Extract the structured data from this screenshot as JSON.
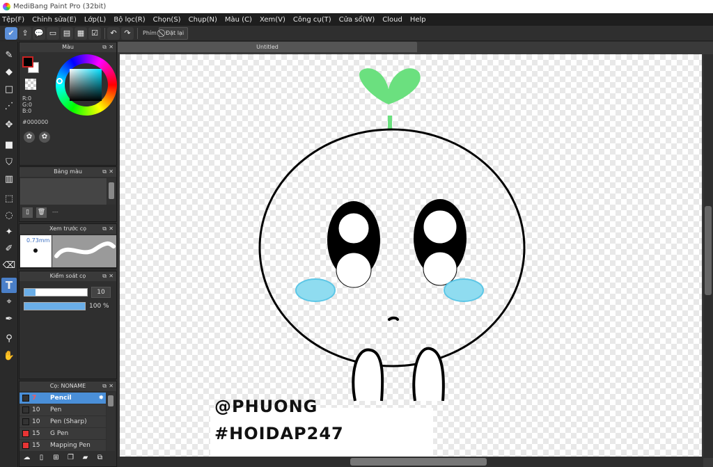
{
  "window": {
    "title": "MediBang Paint Pro (32bit)"
  },
  "menu": [
    "Tệp(F)",
    "Chỉnh sửa(E)",
    "Lớp(L)",
    "Bộ lọc(R)",
    "Chọn(S)",
    "Chụp(N)",
    "Màu (C)",
    "Xem(V)",
    "Công cụ(T)",
    "Cửa sổ(W)",
    "Cloud",
    "Help"
  ],
  "toolbar": {
    "shortcut_label": "Phím",
    "reset_label": "Đặt lại"
  },
  "color_panel": {
    "title": "Màu",
    "r": "R:0",
    "g": "G:0",
    "b": "B:0",
    "hex": "#000000"
  },
  "palette_panel": {
    "title": "Bảng màu",
    "footer_text": "---"
  },
  "brush_preview": {
    "title": "Xem trước cọ",
    "size": "0.73mm"
  },
  "brush_control": {
    "title": "Kiểm soát cọ",
    "size_value": "10",
    "opacity_value": "100 %"
  },
  "brush_list": {
    "title": "Cọ: NONAME",
    "items": [
      {
        "size": "7",
        "name": "Pencil",
        "selected": true,
        "color": "#333333"
      },
      {
        "size": "10",
        "name": "Pen",
        "selected": false,
        "color": "#333333"
      },
      {
        "size": "10",
        "name": "Pen (Sharp)",
        "selected": false,
        "color": "#333333"
      },
      {
        "size": "15",
        "name": "G Pen",
        "selected": false,
        "color": "#e83535"
      },
      {
        "size": "15",
        "name": "Mapping Pen",
        "selected": false,
        "color": "#e83535"
      }
    ]
  },
  "document": {
    "tab_title": "Untitled"
  },
  "artwork": {
    "line1": "@PHUONG",
    "line2": "#HOIDAP247"
  },
  "colors": {
    "accent": "#4a7fc8",
    "sprout": "#6be07f",
    "blush": "#8fdcf0"
  }
}
